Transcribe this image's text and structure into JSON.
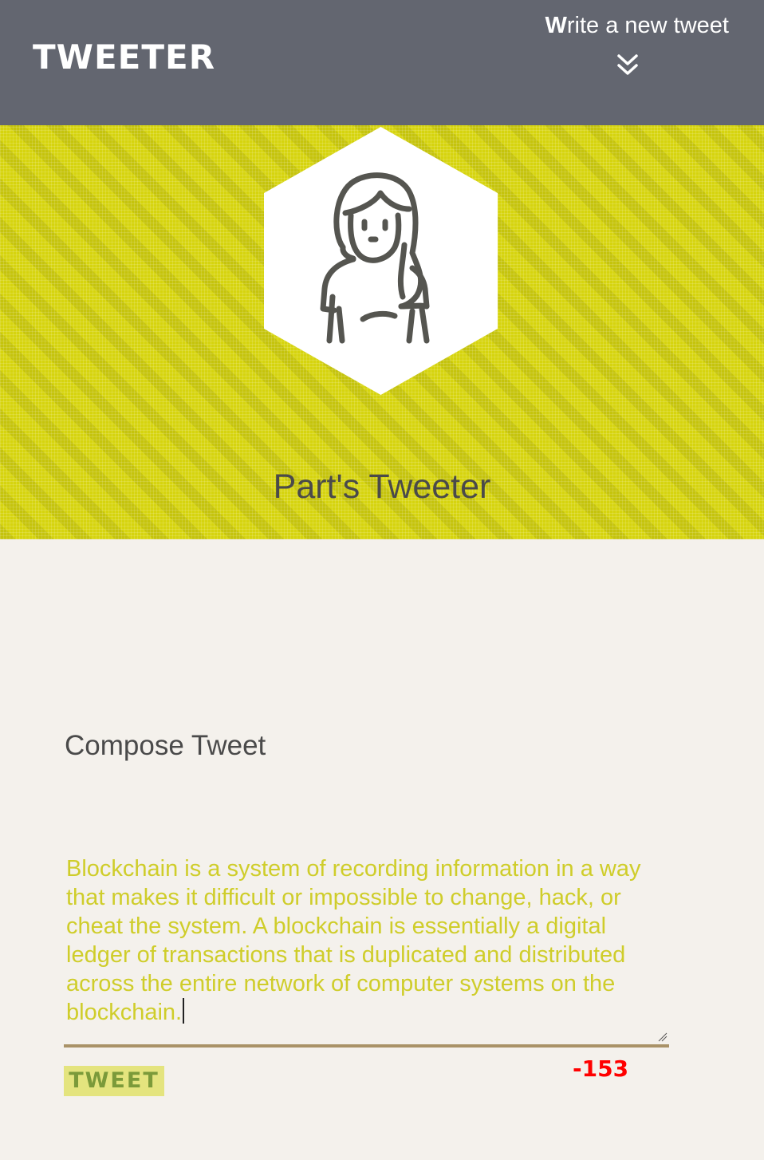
{
  "nav": {
    "brand": "TWEETER",
    "write_link_first": "W",
    "write_link_rest": "rite a new tweet",
    "chevron_icon": "double-chevron-down-icon"
  },
  "header": {
    "avatar_icon": "woman-avatar-icon",
    "handle": "Part's Tweeter",
    "banner_color": "#d6d40e"
  },
  "compose": {
    "title": "Compose Tweet",
    "text": "Blockchain is a system of recording information in a way that makes it difficult or impossible to change, hack, or cheat the system. A blockchain is essentially a digital ledger of transactions that is duplicated and distributed across the entire network of computer systems on the blockchain.",
    "button_label": "TWEET",
    "counter": "-153",
    "counter_color": "#ff0000"
  }
}
